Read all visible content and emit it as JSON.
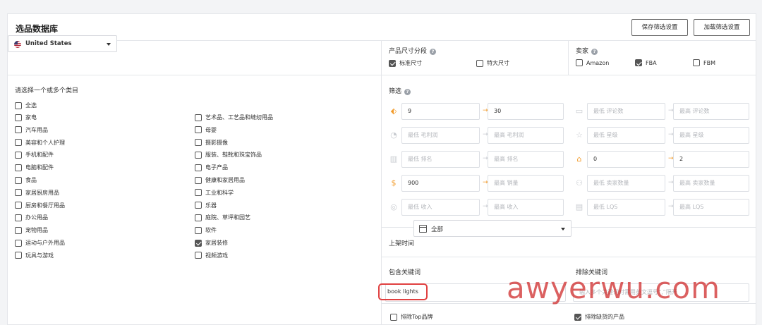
{
  "header": {
    "title": "选品数据库",
    "save_label": "保存筛选设置",
    "load_label": "加载筛选设置"
  },
  "country": {
    "label": "United States"
  },
  "categories": {
    "prompt": "请选择一个或多个类目",
    "select_all": "全选",
    "left": [
      {
        "label": "家电",
        "checked": false
      },
      {
        "label": "汽车用品",
        "checked": false
      },
      {
        "label": "美容和个人护理",
        "checked": false
      },
      {
        "label": "手机和配件",
        "checked": false
      },
      {
        "label": "电脑和配件",
        "checked": false
      },
      {
        "label": "食品",
        "checked": false
      },
      {
        "label": "家居厨房用品",
        "checked": false
      },
      {
        "label": "厨房和餐厅用品",
        "checked": false
      },
      {
        "label": "办公用品",
        "checked": false
      },
      {
        "label": "宠物用品",
        "checked": false
      },
      {
        "label": "运动与户外用品",
        "checked": false
      },
      {
        "label": "玩具与游戏",
        "checked": false
      }
    ],
    "right": [
      {
        "label": "艺术品、工艺品和缝纫用品",
        "checked": false
      },
      {
        "label": "母婴",
        "checked": false
      },
      {
        "label": "摄影摄像",
        "checked": false
      },
      {
        "label": "服装、鞋靴和珠宝饰品",
        "checked": false
      },
      {
        "label": "电子产品",
        "checked": false
      },
      {
        "label": "健康和家居用品",
        "checked": false
      },
      {
        "label": "工业和科学",
        "checked": false
      },
      {
        "label": "乐器",
        "checked": false
      },
      {
        "label": "庭院、草坪和园艺",
        "checked": false
      },
      {
        "label": "软件",
        "checked": false
      },
      {
        "label": "家居装修",
        "checked": true
      },
      {
        "label": "视频游戏",
        "checked": false
      }
    ]
  },
  "size_tier": {
    "label": "产品尺寸分段",
    "options": [
      {
        "label": "标准尺寸",
        "checked": true
      },
      {
        "label": "特大尺寸",
        "checked": false
      }
    ]
  },
  "seller": {
    "label": "卖家",
    "options": [
      {
        "label": "Amazon",
        "checked": false
      },
      {
        "label": "FBA",
        "checked": true
      },
      {
        "label": "FBM",
        "checked": false
      }
    ]
  },
  "filters": {
    "label": "筛选",
    "rows": [
      [
        {
          "icon": "price-tag-icon",
          "min": "9",
          "max": "30",
          "active": true
        },
        {
          "icon": "review-icon",
          "min_ph": "最低 评论数",
          "max_ph": "最高 评论数",
          "active": false
        }
      ],
      [
        {
          "icon": "profit-icon",
          "min_ph": "最低 毛利润",
          "max_ph": "最高 毛利润",
          "active": false
        },
        {
          "icon": "star-icon",
          "min_ph": "最低 星级",
          "max_ph": "最高 星级",
          "active": false
        }
      ],
      [
        {
          "icon": "rank-icon",
          "min_ph": "最低 排名",
          "max_ph": "最高 排名",
          "active": false
        },
        {
          "icon": "weight-icon",
          "min": "0",
          "max": "2",
          "active": true
        }
      ],
      [
        {
          "icon": "sales-icon",
          "min": "900",
          "max_ph": "最高 销量",
          "active": true
        },
        {
          "icon": "sellers-icon",
          "min_ph": "最低 卖家数量",
          "max_ph": "最高 卖家数量",
          "active": false
        }
      ],
      [
        {
          "icon": "revenue-icon",
          "min_ph": "最低 收入",
          "max_ph": "最高 收入",
          "active": false
        },
        {
          "icon": "lqs-icon",
          "min_ph": "最低 LQS",
          "max_ph": "最高 LQS",
          "active": false
        }
      ]
    ]
  },
  "listing_date": {
    "label": "上架时间",
    "value": "全部"
  },
  "keywords": {
    "include_label": "包含关键词",
    "include_value": "book lights",
    "exclude_label": "排除关键词",
    "exclude_placeholder": "输入多个关键词时需用英文逗号“,”隔开"
  },
  "bottom": {
    "exclude_top_brands": {
      "label": "排除Top品牌",
      "checked": false
    },
    "exclude_oos": {
      "label": "排除缺货的产品",
      "checked": true
    }
  },
  "watermark": "awyerwu.com",
  "colors": {
    "accent": "#f29b2a",
    "highlight": "#e04040",
    "watermark": "#cd2323"
  }
}
